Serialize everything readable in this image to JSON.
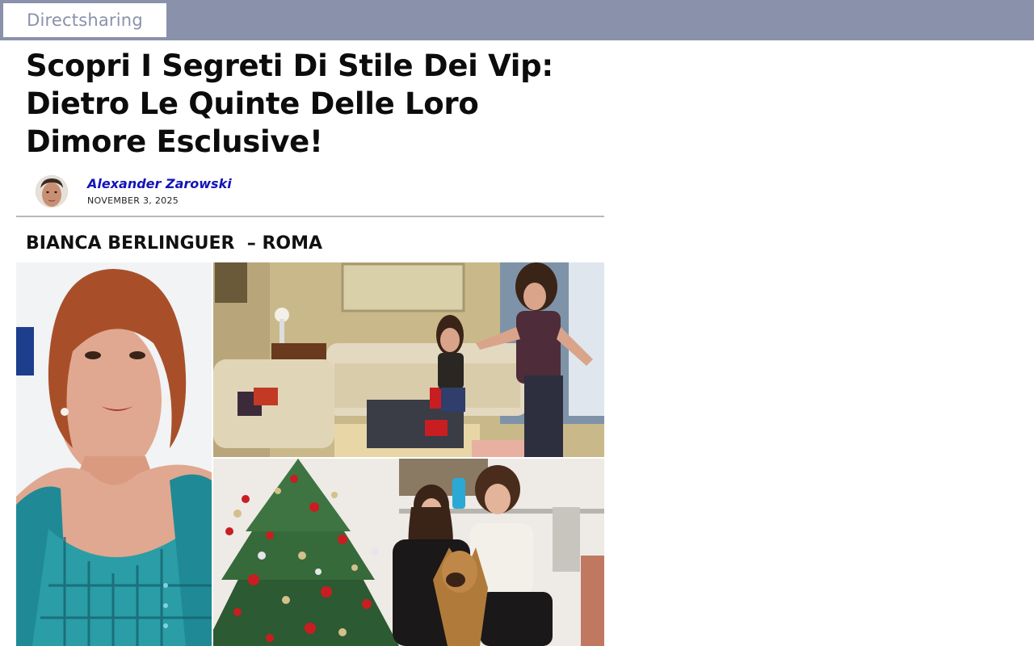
{
  "site": {
    "brand": "Directsharing"
  },
  "article": {
    "title": "Scopri I Segreti Di Stile Dei Vip: Dietro Le Quinte Delle Loro Dimore Esclusive!",
    "author": "Alexander Zarowski",
    "date": "NOVEMBER 3, 2025",
    "section_heading": "BIANCA BERLINGUER  – ROMA"
  },
  "images": {
    "portrait": "woman-portrait-photo",
    "living_room": "living-room-photo",
    "christmas": "christmas-tree-photo"
  },
  "colors": {
    "topbar": "#8a91ab",
    "author_link": "#1414b8"
  }
}
